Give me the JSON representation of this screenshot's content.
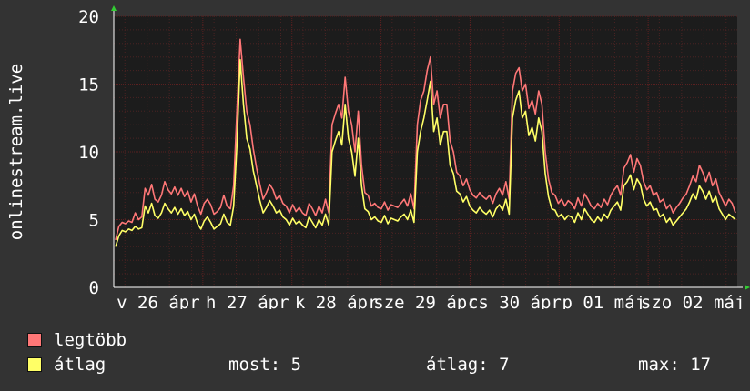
{
  "chart_data": {
    "type": "line",
    "ylabel": "onlinestream.live",
    "ylim": [
      0,
      20
    ],
    "yticks": [
      0,
      5,
      10,
      15,
      20
    ],
    "x_tick_labels": [
      "v 26 ápr",
      "h 27 ápr",
      "k 28 ápr",
      "sze 29 ápr",
      "cs 30 ápr",
      "p 01 máj",
      "szo 02 máj"
    ],
    "grid": true,
    "colors": {
      "background": "#333333",
      "plot_bg": "#1c1c1c",
      "grid": "#5a2020",
      "axis": "#ffffff",
      "max_line": "#ff7777",
      "avg_line": "#ffff66"
    },
    "series": [
      {
        "name": "legtöbb",
        "color": "#ff7777",
        "values": [
          3.5,
          4.5,
          4.8,
          4.7,
          4.9,
          4.8,
          5.5,
          5.0,
          5.2,
          7.3,
          6.8,
          7.6,
          6.5,
          6.3,
          6.8,
          7.8,
          7.2,
          6.9,
          7.4,
          6.8,
          7.3,
          6.7,
          7.1,
          6.3,
          6.9,
          6.0,
          5.4,
          6.2,
          6.5,
          6.1,
          5.4,
          5.6,
          5.9,
          6.8,
          6.0,
          5.8,
          7.5,
          13.0,
          18.3,
          15.5,
          13.0,
          12.0,
          10.2,
          8.8,
          7.6,
          6.5,
          7.0,
          7.6,
          7.2,
          6.5,
          6.8,
          6.2,
          6.0,
          5.5,
          6.1,
          5.6,
          5.9,
          5.5,
          5.3,
          6.2,
          5.8,
          5.3,
          6.0,
          5.5,
          6.5,
          5.5,
          12.0,
          12.8,
          13.5,
          12.5,
          15.5,
          13.0,
          12.0,
          10.0,
          13.0,
          9.0,
          7.0,
          6.8,
          6.0,
          6.2,
          5.9,
          5.8,
          6.3,
          5.7,
          6.1,
          6.0,
          5.9,
          6.2,
          6.5,
          6.0,
          6.9,
          5.8,
          12.0,
          13.8,
          14.5,
          16.0,
          17.0,
          13.5,
          14.5,
          12.5,
          13.5,
          13.5,
          10.8,
          10.0,
          8.5,
          8.2,
          7.5,
          8.0,
          7.2,
          6.8,
          6.6,
          7.0,
          6.7,
          6.5,
          6.8,
          6.2,
          6.9,
          7.3,
          6.8,
          7.8,
          6.5,
          14.5,
          15.8,
          16.2,
          14.5,
          15.0,
          13.2,
          13.8,
          12.8,
          14.5,
          13.5,
          10.0,
          8.0,
          7.0,
          6.8,
          6.2,
          6.5,
          6.0,
          6.4,
          6.2,
          5.8,
          6.6,
          6.0,
          6.9,
          6.5,
          6.0,
          5.8,
          6.2,
          5.9,
          6.5,
          6.1,
          6.8,
          7.2,
          7.5,
          6.8,
          8.8,
          9.2,
          9.8,
          8.5,
          9.5,
          9.0,
          7.8,
          7.2,
          7.5,
          6.8,
          7.0,
          6.3,
          6.5,
          5.8,
          6.1,
          5.5,
          5.9,
          6.2,
          6.6,
          6.9,
          7.5,
          8.2,
          7.8,
          9.0,
          8.5,
          7.8,
          8.5,
          7.5,
          8.0,
          7.0,
          6.5,
          6.0,
          6.5,
          6.2,
          5.5
        ]
      },
      {
        "name": "átlag",
        "color": "#ffff66",
        "values": [
          3.0,
          3.8,
          4.2,
          4.1,
          4.3,
          4.2,
          4.5,
          4.3,
          4.4,
          6.0,
          5.5,
          6.2,
          5.3,
          5.1,
          5.5,
          6.2,
          5.8,
          5.5,
          5.9,
          5.4,
          5.8,
          5.3,
          5.6,
          5.0,
          5.4,
          4.7,
          4.3,
          4.9,
          5.2,
          4.8,
          4.3,
          4.5,
          4.7,
          5.4,
          4.8,
          4.6,
          6.0,
          10.5,
          16.8,
          13.5,
          11.0,
          10.2,
          8.6,
          7.5,
          6.4,
          5.5,
          5.9,
          6.4,
          6.0,
          5.5,
          5.7,
          5.2,
          5.0,
          4.6,
          5.1,
          4.7,
          4.9,
          4.6,
          4.4,
          5.2,
          4.8,
          4.4,
          5.0,
          4.6,
          5.4,
          4.6,
          10.0,
          10.8,
          11.5,
          10.5,
          13.5,
          11.0,
          10.0,
          8.2,
          11.0,
          7.5,
          5.8,
          5.6,
          5.0,
          5.2,
          4.9,
          4.8,
          5.3,
          4.7,
          5.1,
          5.0,
          4.9,
          5.2,
          5.4,
          5.0,
          5.7,
          4.8,
          10.0,
          11.5,
          12.5,
          13.8,
          15.2,
          11.5,
          12.5,
          10.5,
          11.5,
          11.5,
          9.0,
          8.4,
          7.1,
          6.9,
          6.3,
          6.7,
          6.0,
          5.7,
          5.5,
          5.9,
          5.6,
          5.4,
          5.7,
          5.2,
          5.8,
          6.1,
          5.7,
          6.5,
          5.4,
          12.5,
          13.8,
          14.5,
          12.5,
          13.0,
          11.2,
          11.8,
          10.8,
          12.5,
          11.5,
          8.4,
          6.7,
          5.8,
          5.7,
          5.2,
          5.4,
          5.0,
          5.3,
          5.2,
          4.8,
          5.5,
          5.0,
          5.8,
          5.4,
          5.0,
          4.8,
          5.2,
          4.9,
          5.4,
          5.1,
          5.7,
          6.0,
          6.3,
          5.7,
          7.5,
          7.8,
          8.3,
          7.2,
          8.0,
          7.6,
          6.5,
          6.0,
          6.3,
          5.7,
          5.8,
          5.2,
          5.4,
          4.8,
          5.1,
          4.6,
          4.9,
          5.2,
          5.5,
          5.8,
          6.3,
          6.9,
          6.5,
          7.5,
          7.1,
          6.5,
          7.1,
          6.3,
          6.7,
          5.8,
          5.4,
          5.0,
          5.4,
          5.2,
          5.0
        ]
      }
    ]
  },
  "legend": {
    "max_label": "legtöbb",
    "avg_label": "átlag",
    "now_text": "most: 5",
    "avg_text": "átlag: 7",
    "max_text": "max: 17"
  }
}
